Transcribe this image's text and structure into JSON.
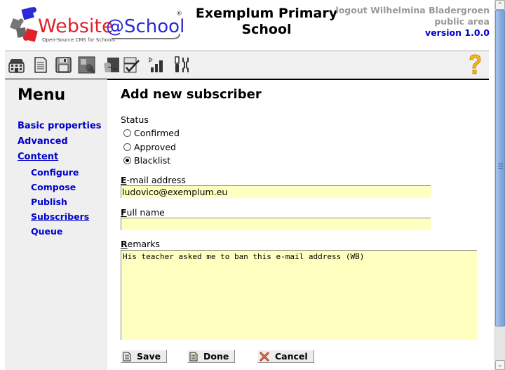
{
  "header": {
    "logo_alt": "Website@School - Open-Source CMS for Schools",
    "logo_text_main": "Website",
    "logo_text_at": "@School",
    "logo_tagline": "Open-Source CMS for Schools",
    "logo_mark": "®",
    "site_title_line1": "Exemplum Primary",
    "site_title_line2": "School",
    "logout_label": "logout Wilhelmina Bladergroen",
    "area_label": "public area",
    "version_label": "version 1.0.0"
  },
  "toolbar": {
    "icons": [
      {
        "name": "start-center-icon",
        "title": "Start Center"
      },
      {
        "name": "page-manager-icon",
        "title": "Page Manager"
      },
      {
        "name": "file-manager-icon",
        "title": "File Manager"
      },
      {
        "name": "modules-icon",
        "title": "Modules"
      },
      {
        "name": "account-manager-icon",
        "title": "Account Manager"
      },
      {
        "name": "configuration-manager-icon",
        "title": "Configuration Manager"
      },
      {
        "name": "statistics-icon",
        "title": "Statistics"
      },
      {
        "name": "tools-icon",
        "title": "Tools"
      }
    ],
    "help_icon": "help-icon"
  },
  "sidebar": {
    "title": "Menu",
    "items": [
      {
        "label": "Basic properties",
        "level": 0,
        "current": false
      },
      {
        "label": "Advanced",
        "level": 0,
        "current": false
      },
      {
        "label": "Content",
        "level": 0,
        "current": true
      },
      {
        "label": "Configure",
        "level": 1,
        "current": false
      },
      {
        "label": "Compose",
        "level": 1,
        "current": false
      },
      {
        "label": "Publish",
        "level": 1,
        "current": false
      },
      {
        "label": "Subscribers",
        "level": 1,
        "current": true
      },
      {
        "label": "Queue",
        "level": 1,
        "current": false
      }
    ]
  },
  "form": {
    "heading": "Add new subscriber",
    "status_label": "Status",
    "status_options": [
      {
        "label": "Confirmed",
        "checked": false
      },
      {
        "label": "Approved",
        "checked": false
      },
      {
        "label": "Blacklist",
        "checked": true
      }
    ],
    "email": {
      "label_key": "E",
      "label_rest": "-mail address",
      "value": "ludovico@exemplum.eu"
    },
    "fullname": {
      "label_key": "F",
      "label_rest": "ull name",
      "value": ""
    },
    "remarks": {
      "label_key": "R",
      "label_rest": "emarks",
      "value": "His teacher asked me to ban this e-mail address (WB)"
    },
    "buttons": {
      "save": "Save",
      "done": "Done",
      "cancel": "Cancel"
    }
  },
  "colors": {
    "link": "#0000cc",
    "field_bg": "#ffffc0",
    "sidebar_bg": "#efefef",
    "muted_text": "#999999"
  }
}
